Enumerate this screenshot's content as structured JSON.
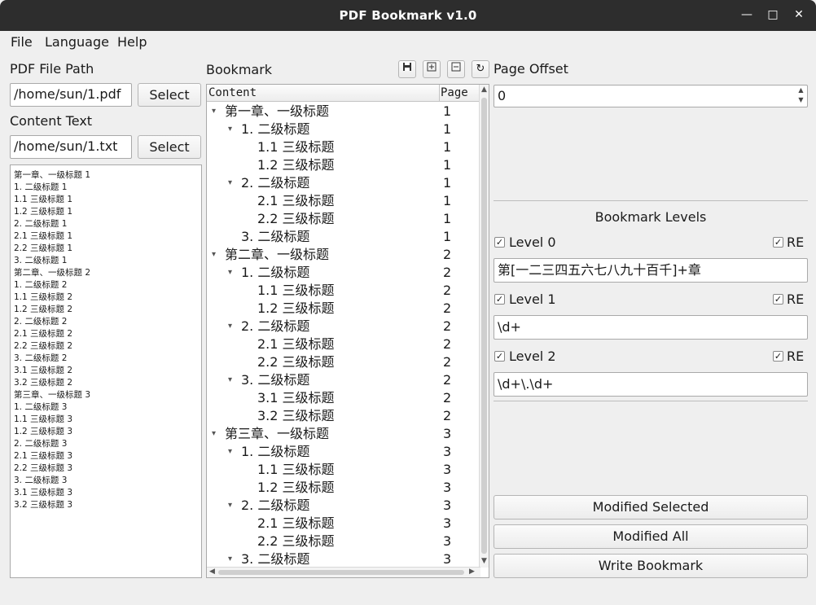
{
  "window": {
    "title": "PDF Bookmark v1.0"
  },
  "menu": [
    "File",
    "Language",
    "Help"
  ],
  "left": {
    "pdf_label": "PDF File Path",
    "pdf_value": "/home/sun/1.pdf",
    "content_label": "Content Text",
    "content_value": "/home/sun/1.txt",
    "select_label": "Select",
    "content_lines": [
      "第一章、一级标题 1",
      "1. 二级标题 1",
      "1.1 三级标题 1",
      "1.2 三级标题 1",
      "2. 二级标题 1",
      "2.1 三级标题 1",
      "2.2 三级标题 1",
      "3. 二级标题 1",
      "第二章、一级标题 2",
      "1. 二级标题 2",
      "1.1 三级标题 2",
      "1.2 三级标题 2",
      "2. 二级标题 2",
      "2.1 三级标题 2",
      "2.2 三级标题 2",
      "3. 二级标题 2",
      "3.1 三级标题 2",
      "3.2 三级标题 2",
      "第三章、一级标题 3",
      "1. 二级标题 3",
      "1.1 三级标题 3",
      "1.2 三级标题 3",
      "2. 二级标题 3",
      "2.1 三级标题 3",
      "2.2 三级标题 3",
      "3. 二级标题 3",
      "3.1 三级标题 3",
      "3.2 三级标题 3"
    ]
  },
  "bookmark": {
    "label": "Bookmark",
    "toolbar_icons": [
      "save-icon",
      "expand-all-icon",
      "collapse-all-icon",
      "refresh-icon"
    ],
    "col_content": "Content",
    "col_page": "Page",
    "rows": [
      {
        "level": 0,
        "text": "第一章、一级标题",
        "page": "1",
        "expanded": true
      },
      {
        "level": 1,
        "text": "1. 二级标题",
        "page": "1",
        "expanded": true
      },
      {
        "level": 2,
        "text": "1.1 三级标题",
        "page": "1"
      },
      {
        "level": 2,
        "text": "1.2 三级标题",
        "page": "1"
      },
      {
        "level": 1,
        "text": "2. 二级标题",
        "page": "1",
        "expanded": true
      },
      {
        "level": 2,
        "text": "2.1 三级标题",
        "page": "1"
      },
      {
        "level": 2,
        "text": "2.2 三级标题",
        "page": "1"
      },
      {
        "level": 1,
        "text": "3. 二级标题",
        "page": "1"
      },
      {
        "level": 0,
        "text": "第二章、一级标题",
        "page": "2",
        "expanded": true
      },
      {
        "level": 1,
        "text": "1. 二级标题",
        "page": "2",
        "expanded": true
      },
      {
        "level": 2,
        "text": "1.1 三级标题",
        "page": "2"
      },
      {
        "level": 2,
        "text": "1.2 三级标题",
        "page": "2"
      },
      {
        "level": 1,
        "text": "2. 二级标题",
        "page": "2",
        "expanded": true
      },
      {
        "level": 2,
        "text": "2.1 三级标题",
        "page": "2"
      },
      {
        "level": 2,
        "text": "2.2 三级标题",
        "page": "2"
      },
      {
        "level": 1,
        "text": "3. 二级标题",
        "page": "2",
        "expanded": true
      },
      {
        "level": 2,
        "text": "3.1 三级标题",
        "page": "2"
      },
      {
        "level": 2,
        "text": "3.2 三级标题",
        "page": "2"
      },
      {
        "level": 0,
        "text": "第三章、一级标题",
        "page": "3",
        "expanded": true
      },
      {
        "level": 1,
        "text": "1. 二级标题",
        "page": "3",
        "expanded": true
      },
      {
        "level": 2,
        "text": "1.1 三级标题",
        "page": "3"
      },
      {
        "level": 2,
        "text": "1.2 三级标题",
        "page": "3"
      },
      {
        "level": 1,
        "text": "2. 二级标题",
        "page": "3",
        "expanded": true
      },
      {
        "level": 2,
        "text": "2.1 三级标题",
        "page": "3"
      },
      {
        "level": 2,
        "text": "2.2 三级标题",
        "page": "3"
      },
      {
        "level": 1,
        "text": "3. 二级标题",
        "page": "3",
        "expanded": true
      }
    ]
  },
  "right": {
    "offset_label": "Page Offset",
    "offset_value": "0",
    "levels_title": "Bookmark Levels",
    "re_label": "RE",
    "levels": [
      {
        "label": "Level 0",
        "checked": true,
        "re": true,
        "pattern": "第[一二三四五六七八九十百千]+章"
      },
      {
        "label": "Level 1",
        "checked": true,
        "re": true,
        "pattern": "\\d+"
      },
      {
        "label": "Level 2",
        "checked": true,
        "re": true,
        "pattern": "\\d+\\.\\d+"
      }
    ],
    "modified_selected": "Modified Selected",
    "modified_all": "Modified All",
    "write_bookmark": "Write Bookmark"
  }
}
